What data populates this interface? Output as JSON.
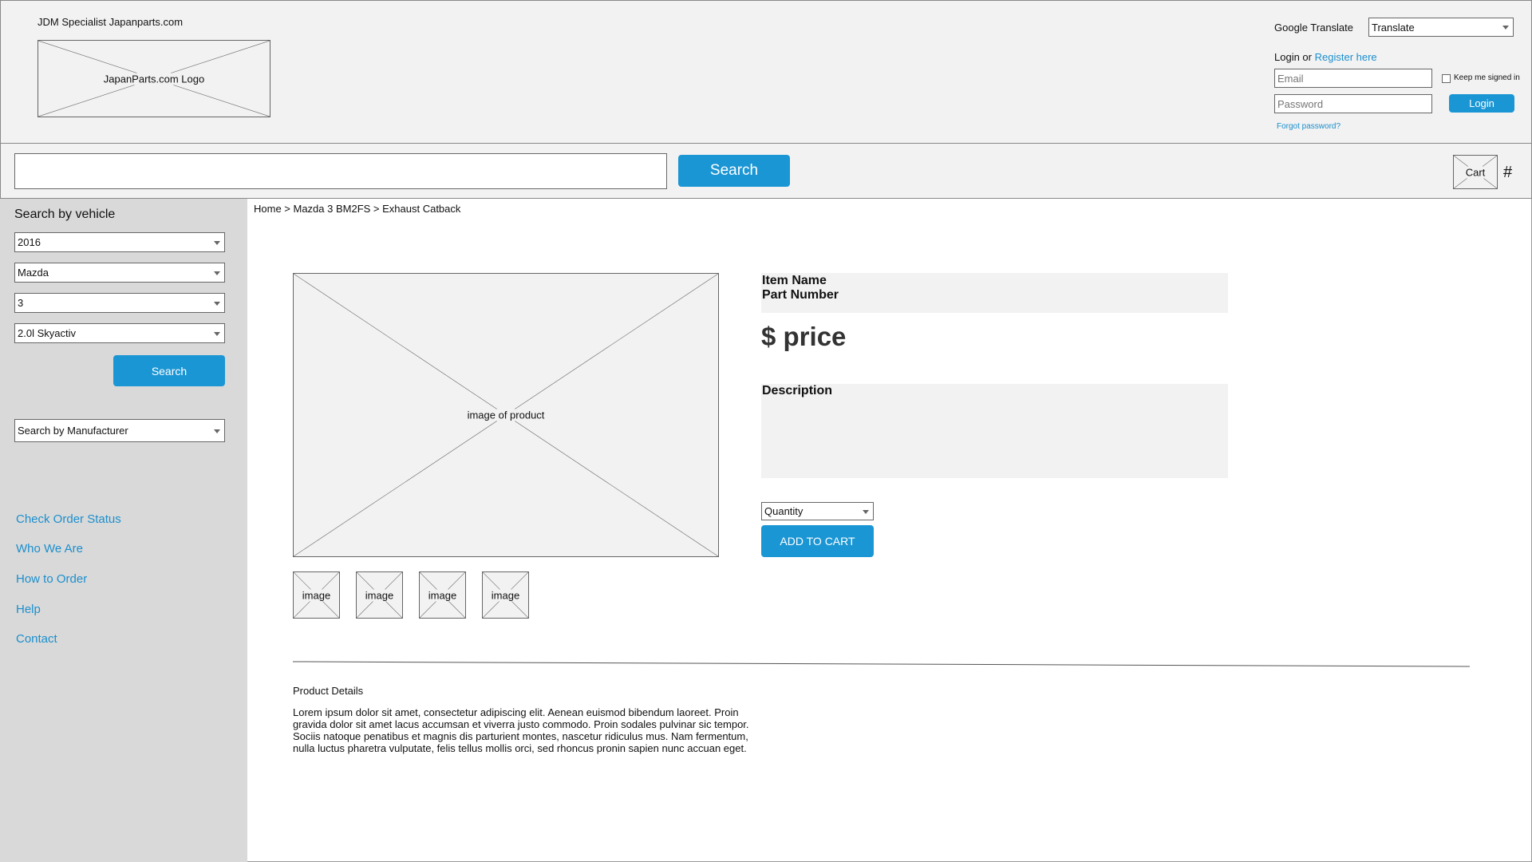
{
  "header": {
    "site_title": "JDM Specialist Japanparts.com",
    "logo_label": "JapanParts.com Logo",
    "translate_label": "Google Translate",
    "translate_select": "Translate",
    "login_text": "Login or",
    "register_link": "Register here",
    "email_placeholder": "Email",
    "password_placeholder": "Password",
    "keep_signed_in": "Keep me signed in",
    "login_button": "Login",
    "forgot_password": "Forgot password?"
  },
  "search_bar": {
    "input_value": "",
    "search_button": "Search",
    "cart_label": "Cart",
    "cart_count": "#"
  },
  "sidebar": {
    "heading": "Search by vehicle",
    "year": "2016",
    "make": "Mazda",
    "model": "3",
    "engine": "2.0l Skyactiv",
    "search_button": "Search",
    "manufacturer_select": "Search by Manufacturer",
    "links": [
      "Check Order Status",
      "Who We Are",
      "How to Order",
      "Help",
      "Contact"
    ]
  },
  "breadcrumb": "Home > Mazda 3 BM2FS > Exhaust Catback",
  "product": {
    "main_image_label": "image of product",
    "thumbnails": [
      "image",
      "image",
      "image",
      "image"
    ],
    "item_name": "Item Name",
    "part_number": "Part Number",
    "price": "$ price",
    "description_label": "Description",
    "quantity_select": "Quantity",
    "add_to_cart": "ADD TO CART"
  },
  "details": {
    "heading": "Product Details",
    "body": "Lorem ipsum dolor sit amet, consectetur adipiscing elit. Aenean euismod bibendum laoreet. Proin gravida dolor sit amet lacus accumsan et viverra justo commodo. Proin sodales pulvinar sic tempor. Sociis natoque penatibus et magnis dis parturient montes, nascetur ridiculus mus. Nam fermentum, nulla luctus pharetra vulputate, felis tellus mollis orci, sed rhoncus pronin sapien nunc accuan eget."
  }
}
